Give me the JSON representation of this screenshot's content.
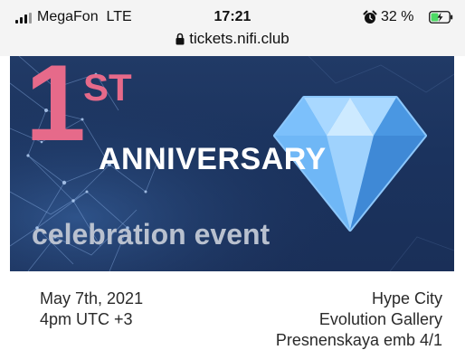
{
  "status_bar": {
    "carrier": "MegaFon",
    "network": "LTE",
    "time": "17:21",
    "battery_percent": "32 %",
    "icons": [
      "signal-icon",
      "alarm-icon",
      "battery-charging-icon"
    ]
  },
  "browser": {
    "url": "tickets.nifi.club",
    "secure_icon": "lock-icon"
  },
  "banner": {
    "number": "1",
    "ordinal_suffix": "ST",
    "headline": "ANNIVERSARY",
    "subheadline": "celebration event",
    "graphic": "diamond-icon",
    "colors": {
      "background": "#1d3560",
      "ordinal": "#e66a8a",
      "headline": "#ffffff",
      "subheadline": "#b9c1cf",
      "diamond": "#5aa9f0"
    }
  },
  "event": {
    "date": "May 7th, 2021",
    "time": "4pm UTC +3",
    "venue_lines": [
      "Hype City",
      "Evolution Gallery",
      "Presnenskaya emb 4/1"
    ]
  }
}
